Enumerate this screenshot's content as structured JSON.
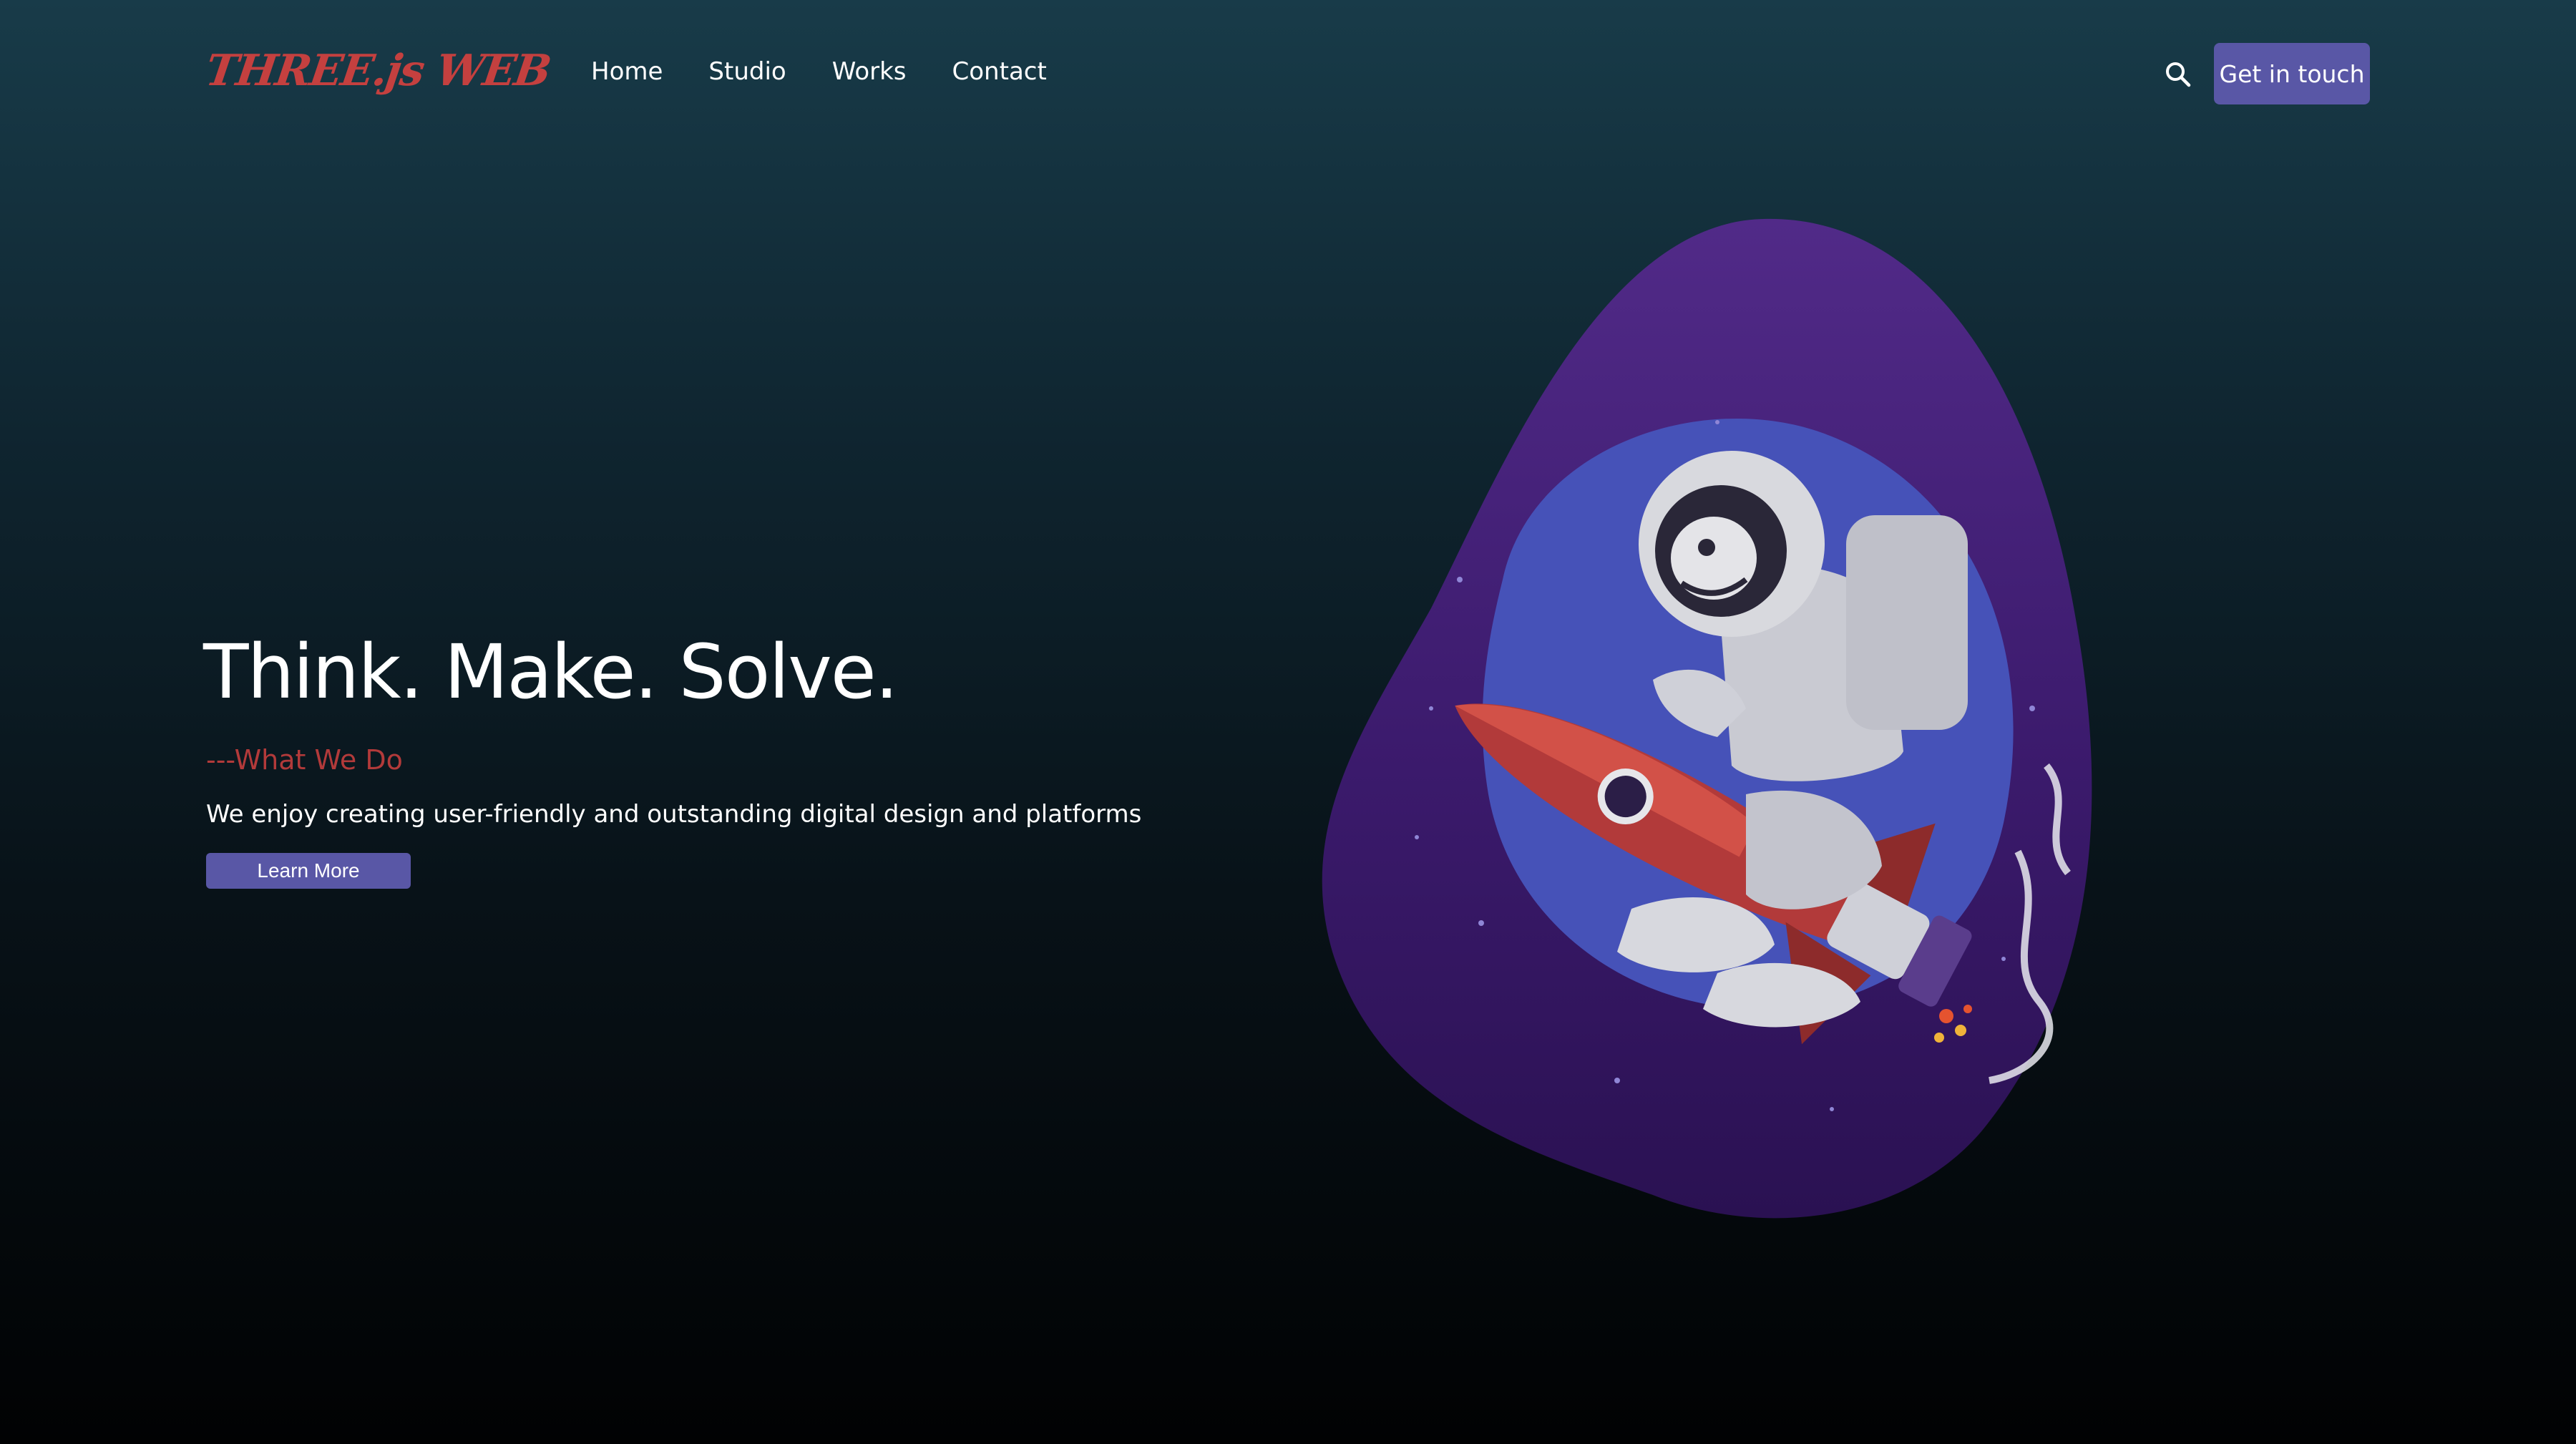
{
  "brand": {
    "logo_text": "THREE.js WEB",
    "logo_color": "#c4403f"
  },
  "nav": {
    "items": [
      {
        "label": "Home"
      },
      {
        "label": "Studio"
      },
      {
        "label": "Works"
      },
      {
        "label": "Contact"
      }
    ]
  },
  "header": {
    "search_icon": "search-icon",
    "cta_label": "Get in touch"
  },
  "hero": {
    "title": "Think. Make. Solve.",
    "subtitle": "---What We Do",
    "description": "We enjoy creating user-friendly and outstanding digital design and platforms",
    "button_label": "Learn More"
  },
  "colors": {
    "accent": "#5957a6",
    "brand_red": "#c4403f",
    "blob_purple": "#4a1f7e",
    "planet_blue": "#4652b8"
  }
}
